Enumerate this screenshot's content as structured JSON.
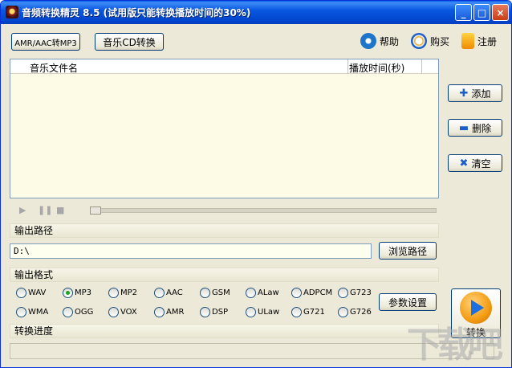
{
  "window": {
    "title": "音频转换精灵 8.5 (试用版只能转换播放时间的30%)",
    "controls": {
      "minimize": "_",
      "maximize": "□",
      "close": "×"
    }
  },
  "toolbar": {
    "amr_button": "AMR/AAC转MP3",
    "cd_button": "音乐CD转换",
    "help": "帮助",
    "buy": "购买",
    "register": "注册"
  },
  "filelist": {
    "columns": [
      "音乐文件名",
      "播放时间(秒)"
    ],
    "rows": []
  },
  "side_buttons": {
    "add": "添加",
    "delete": "删除",
    "clear": "清空"
  },
  "output_path": {
    "label": "输出路径",
    "value": "D:\\",
    "browse_button": "浏览路径"
  },
  "output_format": {
    "label": "输出格式",
    "options": [
      "WAV",
      "MP3",
      "MP2",
      "AAC",
      "GSM",
      "ALaw",
      "ADPCM",
      "G723",
      "WMA",
      "OGG",
      "VOX",
      "AMR",
      "DSP",
      "ULaw",
      "G721",
      "G726"
    ],
    "selected": "MP3",
    "params_button": "参数设置"
  },
  "convert": {
    "label": "转换"
  },
  "progress": {
    "label": "转换进度",
    "value": 0
  },
  "colors": {
    "titlebar": "#0a58e0",
    "list_bg": "#fdfbe6",
    "accent": "#f39c12"
  }
}
